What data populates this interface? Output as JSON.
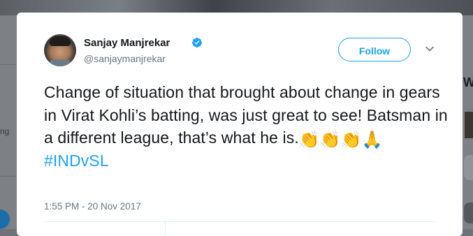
{
  "background": {
    "left_text": "ng",
    "right_text": "W"
  },
  "tweet": {
    "display_name": "Sanjay Manjrekar",
    "handle": "@sanjaymanjrekar",
    "follow_label": "Follow",
    "text": "Change of situation that brought about change in gears in Virat Kohli’s batting, was just great to see! Batsman in a different league, that’s what he is.",
    "emojis": [
      "👏",
      "👏",
      "👏",
      "🙏"
    ],
    "hashtag": "#INDvSL",
    "timestamp": "1:55 PM - 20 Nov 2017"
  },
  "icons": {
    "verified": "verified-badge-icon",
    "caret": "chevron-down-icon"
  },
  "colors": {
    "accent": "#1da1f2",
    "text": "#14171a",
    "secondary": "#657786"
  }
}
